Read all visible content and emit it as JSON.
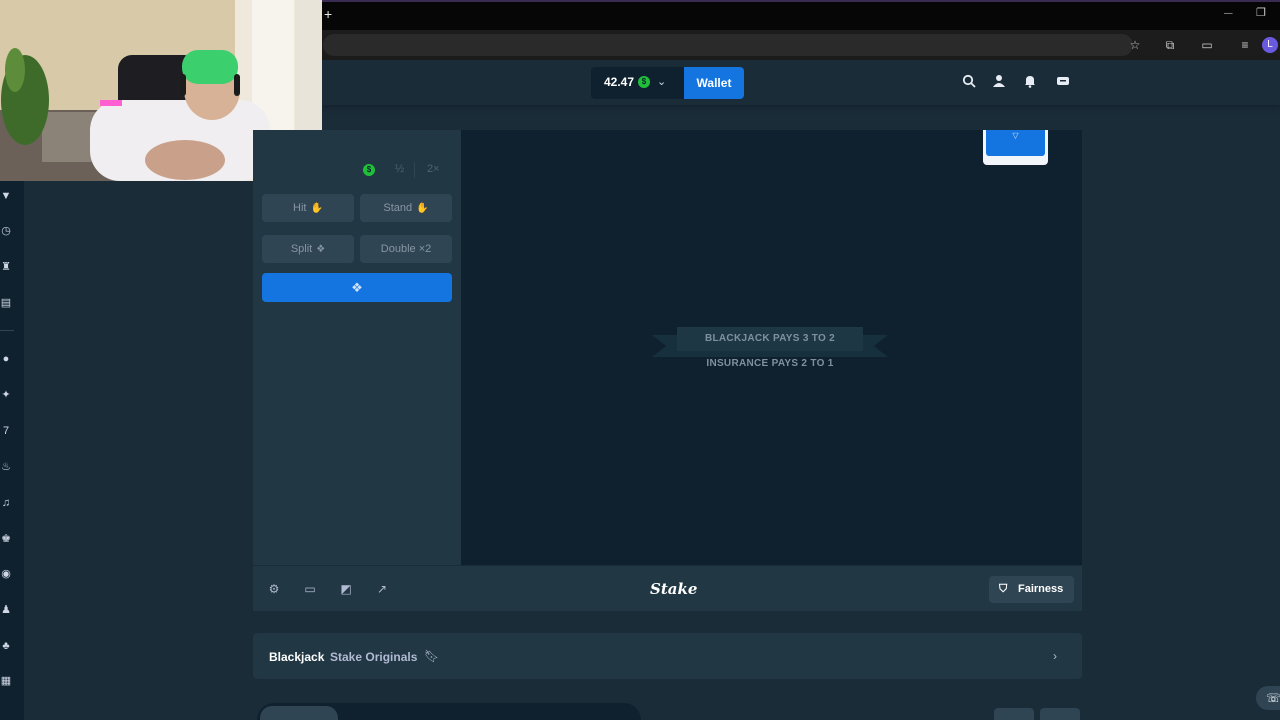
{
  "browser": {
    "new_tab_icon": "plus-icon",
    "minimize_icon": "minimize-icon",
    "restore_icon": "restore-icon",
    "toolbar_icons": [
      "star-icon",
      "extension-icon",
      "cast-icon",
      "media-icon"
    ],
    "profile_initial": "L"
  },
  "header": {
    "balance": "42.47",
    "currency_symbol": "$",
    "wallet_label": "Wallet",
    "icons": [
      "search-icon",
      "user-icon",
      "bell-icon",
      "chat-icon"
    ]
  },
  "sidebar": {
    "icons": [
      "bookmark-icon",
      "clock-icon",
      "trophy-icon",
      "chat-bubble-icon",
      "stake-originals-icon",
      "sparkle-icon",
      "slots-icon",
      "fire-icon",
      "live-casino-icon",
      "gameshow-icon",
      "roulette-icon",
      "table-games-icon",
      "mushroom-icon",
      "grid-icon"
    ]
  },
  "controls": {
    "currency_symbol": "$",
    "half_label": "½",
    "double_label": "2×",
    "hit_label": "Hit",
    "stand_label": "Stand",
    "split_label": "Split",
    "double_label_btn": "Double",
    "double_multiplier": "×2",
    "bet_icon": "cards-icon"
  },
  "game": {
    "pays_text": "BLACKJACK PAYS 3 TO 2",
    "insurance_text": "INSURANCE PAYS 2 TO 1"
  },
  "footer": {
    "icons": [
      "settings-icon",
      "theatre-mode-icon",
      "stats-icon",
      "popout-icon"
    ],
    "logo": "Stake",
    "fairness_label": "Fairness"
  },
  "info": {
    "game_name": "Blackjack",
    "provider": "Stake Originals"
  },
  "colors": {
    "background": "#1a2c38",
    "panel": "#213743",
    "game_area": "#0f212e",
    "accent": "#1475e1",
    "coin": "#1fbf3a"
  }
}
